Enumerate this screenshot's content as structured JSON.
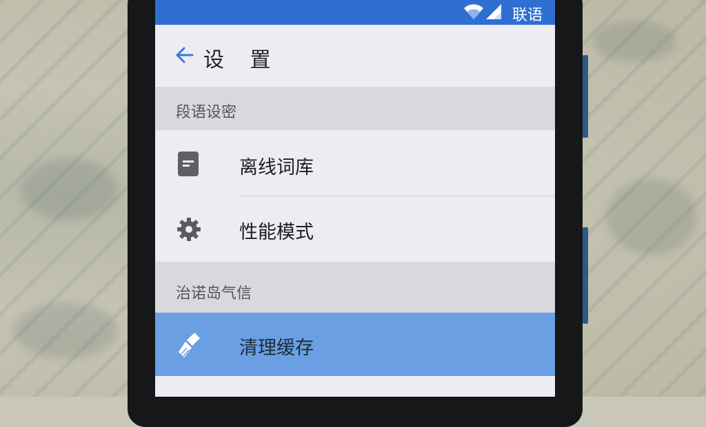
{
  "status_bar": {
    "carrier_text": "联语",
    "wifi_icon": "wifi-icon",
    "signal_icon": "signal-icon",
    "color": "#2f6fd2"
  },
  "app_bar": {
    "back_icon": "back-arrow-icon",
    "title": "设 置"
  },
  "sections": [
    {
      "header": "段语设密",
      "items": [
        {
          "icon": "document-icon",
          "label": "离线词库"
        },
        {
          "icon": "gear-icon",
          "label": "性能模式"
        }
      ]
    },
    {
      "header": "治诺岛气信",
      "items": [
        {
          "icon": "broom-icon",
          "label": "清理缓存",
          "selected": true
        }
      ]
    }
  ],
  "colors": {
    "accent": "#2f6fd2",
    "selected_row": "#6a9fe3",
    "section_bg": "#d8d8de",
    "row_bg": "#ececf2"
  }
}
